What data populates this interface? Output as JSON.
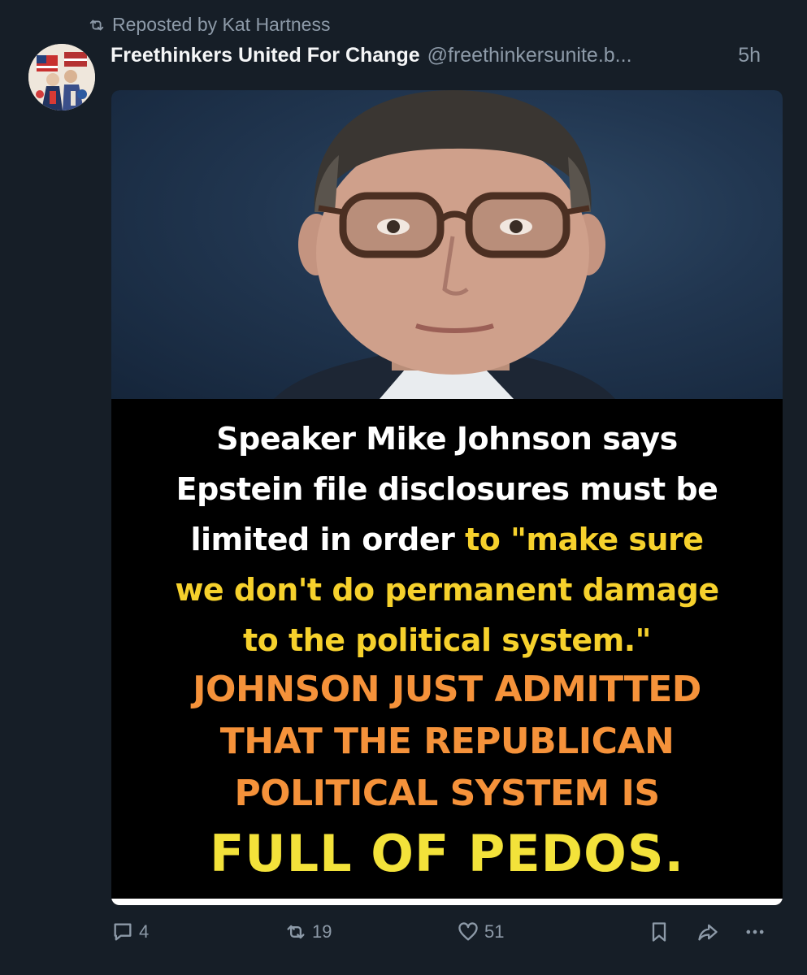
{
  "repost": {
    "icon": "repost-icon",
    "label": "Reposted by Kat Hartness"
  },
  "author": {
    "name": "Freethinkers United For Change",
    "handle": "@freethinkersunite.b...",
    "time": "5h",
    "avatar": "avatar-image"
  },
  "image": {
    "photo": "portrait-photo",
    "caption": {
      "line1": "Speaker Mike Johnson says",
      "line2": "Epstein file disclosures must be",
      "line3_white": "limited in order ",
      "line3_yellow": "to \"make sure",
      "line4": "we don't do permanent damage",
      "line5": "to the political system.\"",
      "line6": "JOHNSON JUST ADMITTED",
      "line7": "THAT THE REPUBLICAN",
      "line8": "POLITICAL SYSTEM IS",
      "line9": "FULL OF PEDOS."
    }
  },
  "actions": {
    "reply": {
      "icon": "comment-icon",
      "count": "4"
    },
    "repost": {
      "icon": "repost-icon",
      "count": "19"
    },
    "like": {
      "icon": "heart-icon",
      "count": "51"
    },
    "bookmark": {
      "icon": "bookmark-icon"
    },
    "share": {
      "icon": "share-icon"
    },
    "more": {
      "icon": "more-icon"
    }
  },
  "colors": {
    "background": "#161e27",
    "muted_text": "#8d9aa8",
    "caption_yellow": "#f6d12c",
    "caption_orange": "#f5923a"
  }
}
